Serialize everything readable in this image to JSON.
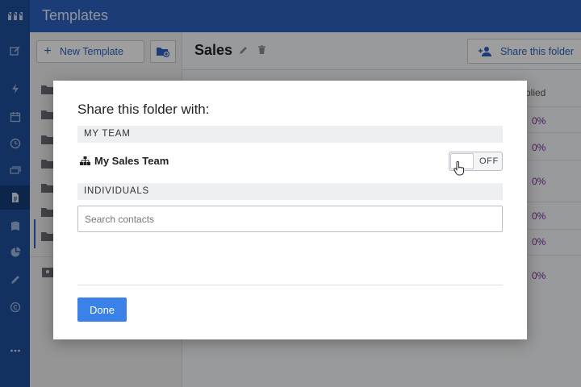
{
  "app": {
    "title": "Templates"
  },
  "sidebar": {
    "icons": [
      "logo-icon",
      "compose-icon",
      "bolt-icon",
      "calendar-icon",
      "clock-icon",
      "inbox-icon",
      "document-icon",
      "book-icon",
      "pie-chart-icon",
      "pen-icon",
      "copyright-icon",
      "more-icon"
    ],
    "active": "document-icon"
  },
  "left_pane": {
    "new_template_label": "New Template"
  },
  "main": {
    "folder_name": "Sales",
    "share_button_label": "Share this folder",
    "column_header": "plied",
    "percent_values": [
      "0%",
      "0%",
      "0%",
      "0%",
      "0%",
      "0%"
    ]
  },
  "modal": {
    "title": "Share this folder with:",
    "my_team_header": "MY TEAM",
    "team_name": "My Sales Team",
    "toggle_state": "OFF",
    "individuals_header": "INDIVIDUALS",
    "search_placeholder": "Search contacts",
    "search_value": "",
    "done_label": "Done"
  },
  "colors": {
    "topbar": "#2c62c0",
    "rail": "#1f4f9c",
    "accent": "#3b82e8",
    "percent": "#7b2d9a"
  }
}
